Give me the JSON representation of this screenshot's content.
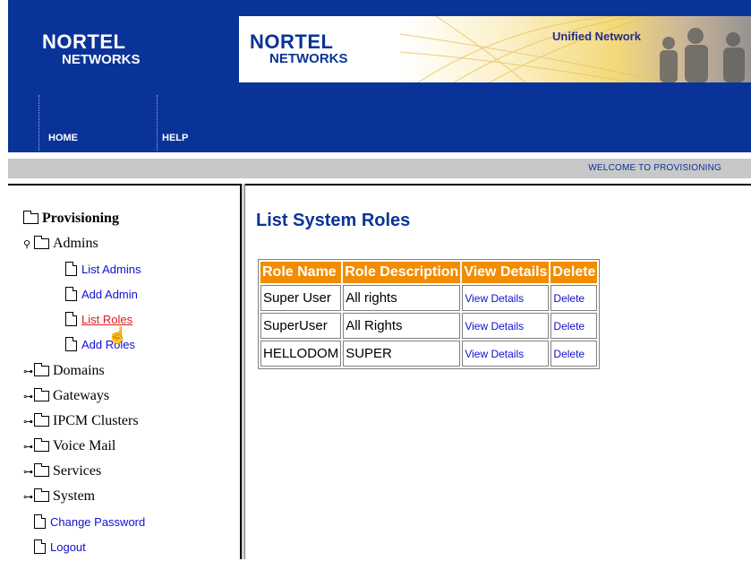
{
  "header": {
    "logo_line1": "NORTEL",
    "logo_line2": "NETWORKS",
    "banner_logo_line1": "NORTEL",
    "banner_logo_line2": "NETWORKS",
    "banner_tagline": "Unified Network",
    "nav": [
      {
        "label": "HOME"
      },
      {
        "label": "HELP"
      }
    ]
  },
  "welcome_text": "WELCOME TO PROVISIONING",
  "tree": {
    "root_label": "Provisioning",
    "admins_label": "Admins",
    "admin_children": [
      {
        "label": "List Admins"
      },
      {
        "label": "Add Admin"
      },
      {
        "label": "List Roles"
      },
      {
        "label": "Add Roles"
      }
    ],
    "folders": [
      {
        "label": "Domains"
      },
      {
        "label": "Gateways"
      },
      {
        "label": "IPCM Clusters"
      },
      {
        "label": "Voice Mail"
      },
      {
        "label": "Services"
      },
      {
        "label": "System"
      }
    ],
    "links": [
      {
        "label": "Change Password"
      },
      {
        "label": "Logout"
      }
    ]
  },
  "main": {
    "title": "List System Roles",
    "columns": [
      "Role Name",
      "Role Description",
      "View Details",
      "Delete"
    ],
    "rows": [
      {
        "name": "Super User",
        "description": "All rights",
        "view": "View Details",
        "delete": "Delete"
      },
      {
        "name": "SuperUser",
        "description": "All Rights",
        "view": "View Details",
        "delete": "Delete"
      },
      {
        "name": "HELLODOM",
        "description": "SUPER",
        "view": "View Details",
        "delete": "Delete"
      }
    ]
  },
  "colors": {
    "header_blue": "#0a3399",
    "table_header_orange": "#f28c00",
    "link_blue": "#1010d0",
    "active_link_red": "#e01818"
  },
  "icons": [
    "folder-icon",
    "page-icon",
    "expand-icon",
    "hand-cursor-icon"
  ]
}
